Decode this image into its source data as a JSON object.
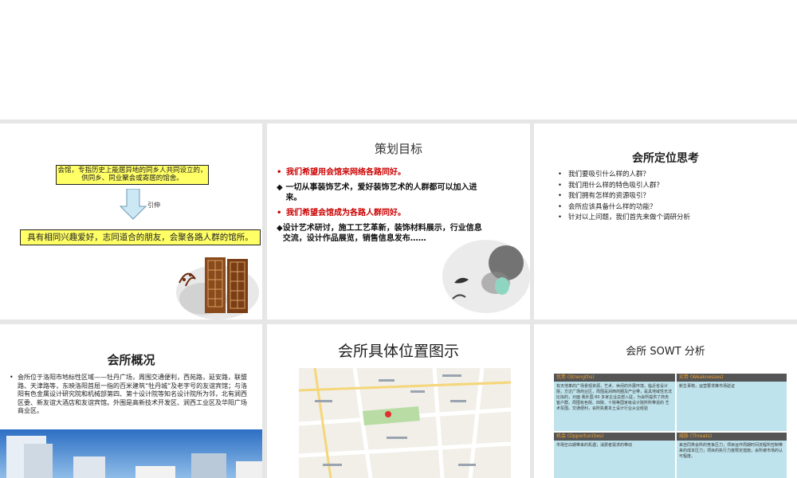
{
  "slide1": {
    "box_top": "会馆，专指历史上能居异地的同乡人共同设立的，供同乡、同业聚会或寄居的馆舍。",
    "arrow_label": "引伸",
    "box_bottom": "具有相同兴趣爱好，志同道合的朋友，会聚各路人群的馆所。"
  },
  "slide2": {
    "title": "策划目标",
    "line1": "我们希望用会馆来网络各路同好。",
    "line2": "一切从事装饰艺术，爱好装饰艺术的人群都可以加入进来。",
    "line3": "我们希望会馆成为各路人群同好。",
    "line4": "设计艺术研讨，施工工艺革新，装饰材料展示，行业信息交流，设计作品展览，销售信息发布……"
  },
  "slide3": {
    "title": "会所定位思考",
    "items": [
      "我们要吸引什么样的人群？",
      "我们用什么样的特色吸引人群？",
      "我们拥有怎样的资源吸引？",
      "会所应该具备什么样的功能？",
      "针对以上问题，我们首先来做个调研分析"
    ]
  },
  "slide4": {
    "title": "会所概况",
    "text": "会所位于洛阳市地标性区域——牡丹广场，周围交通便利，西苑路，延安路，联盟路、天津路等，东映洛阳首屈一指的百米建筑“牡丹城”及老字号的友谊宾馆；与洛阳有色金属设计研究院和机械部第四、第十设计院等知名设计院所为邻，北有涧西区委、新友谊大酒店和友谊宾馆。外围是高新技术开发区、涧西工业区及华阳广场商业区。"
  },
  "slide5": {
    "title": "会所具体位置图示"
  },
  "slide6": {
    "title": "会所 SOWT 分析",
    "cells": [
      {
        "header": "优势 (Strengths)",
        "body": "有天地革的广场景观资源，艺术、休闲的外展环境。临近省设计院，方达广场商业区，周围是涧西商圈及产业带，是具地域性无法比拟的，对面 我外国 80 多家企业总部入驻，为会所提供了商务客户群。周围有色院、四院、十院等国家级设计院所所带造的 艺术氛围。交通便利，会所执着本土设计行业从业经验"
      },
      {
        "header": "劣势 (Weaknesses)",
        "body": "新生事物，运营要求推市场验证"
      },
      {
        "header": "机会 (Opportunities)",
        "body": "市场空白期带来的机遇；消费者需求的带动"
      },
      {
        "header": "威胁 (Threats)",
        "body": "来自同类会所的竞争压力；项目运作周期时间流程所控制带来的成本压力；项目的执行力度限定措施；会所被市场的认可程度。"
      }
    ]
  }
}
